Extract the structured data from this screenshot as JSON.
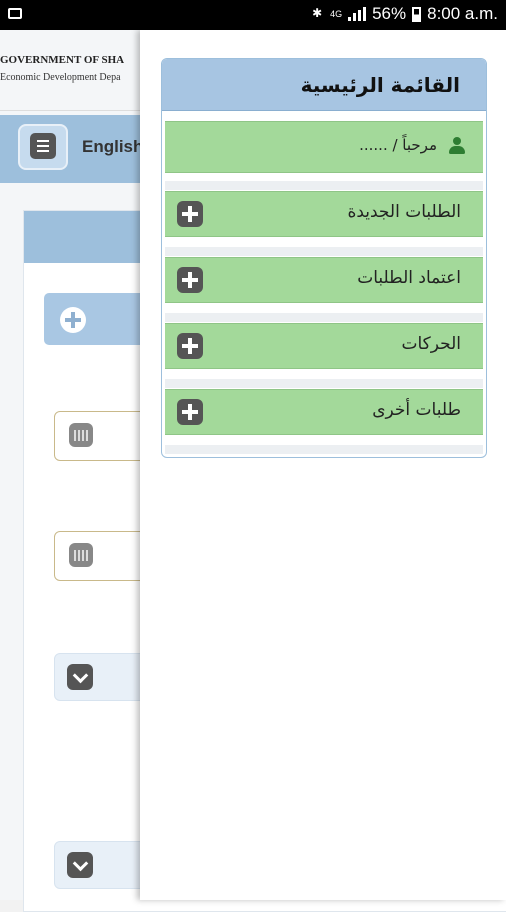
{
  "status_bar": {
    "battery": "56%",
    "time": "8:00 a.m.",
    "network": "4G"
  },
  "background_page": {
    "org_title": "GOVERNMENT OF SHA",
    "org_subtitle": "Economic Development Depa",
    "language_button": "English"
  },
  "drawer": {
    "title": "القائمة الرئيسية",
    "welcome": "مرحباً / ......",
    "items": [
      {
        "label": "الطلبات الجديدة",
        "icon": "plus-icon"
      },
      {
        "label": "اعتماد الطلبات",
        "icon": "plus-icon"
      },
      {
        "label": "الحركات",
        "icon": "plus-icon"
      },
      {
        "label": "طلبات أخرى",
        "icon": "plus-icon"
      }
    ]
  },
  "colors": {
    "header_blue": "#a7c5e2",
    "item_green": "#a3d99a",
    "user_icon_green": "#2e7d32"
  }
}
